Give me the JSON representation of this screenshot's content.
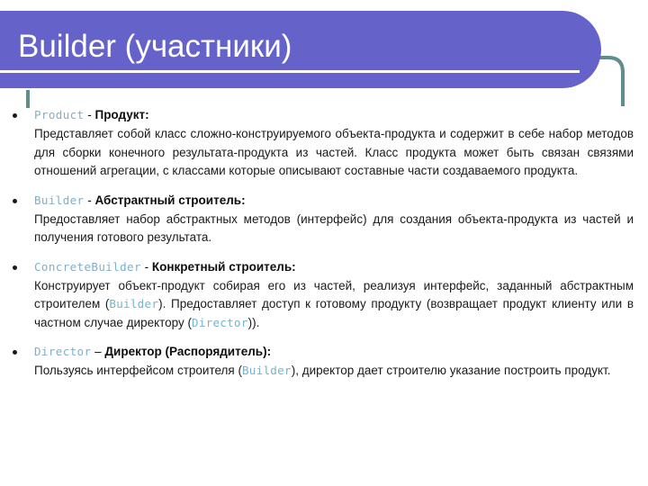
{
  "slide": {
    "title": "Builder (участники)",
    "theme": {
      "banner_color": "#6563c9",
      "banner_rule_color": "#ffffff",
      "accent_line_color": "#5f8e8e",
      "keyword_color": "#7fafc9",
      "inline_keyword_color": "#74b3cf",
      "body_text_color": "#1a1a1a",
      "background_color": "#ffffff"
    }
  },
  "bullets": [
    {
      "keyword": "Product",
      "separator": " - ",
      "term": "Продукт",
      "colon": ":",
      "body_parts": [
        {
          "type": "text",
          "value": "Представляет собой класс сложно-конструируемого объекта-продукта и содержит в себе набор методов для сборки конечного результата-продукта из частей. Класс продукта может быть связан связями отношений агрегации, с классами которые описывают составные части создаваемого продукта."
        }
      ]
    },
    {
      "keyword": "Builder",
      "separator": " - ",
      "term": "Абстрактный строитель",
      "colon": ":",
      "body_parts": [
        {
          "type": "text",
          "value": "Предоставляет набор абстрактных методов (интерфейс) для создания объекта-продукта из частей и получения готового результата."
        }
      ]
    },
    {
      "keyword": "ConcreteBuilder",
      "separator": " - ",
      "term": "Конкретный строитель",
      "colon": ":",
      "body_parts": [
        {
          "type": "text",
          "value": "Конструирует объект-продукт собирая его из частей, реализуя интерфейс, заданный абстрактным строителем ("
        },
        {
          "type": "keyword",
          "value": "Builder"
        },
        {
          "type": "text",
          "value": "). Предоставляет доступ к готовому продукту (возвращает продукт клиенту или в частном случае директору ("
        },
        {
          "type": "keyword",
          "value": "Director"
        },
        {
          "type": "text",
          "value": "))."
        }
      ]
    },
    {
      "keyword": "Director",
      "separator": " – ",
      "term": "Директор (Распорядитель)",
      "colon": ":",
      "body_parts": [
        {
          "type": "text",
          "value": " Пользуясь интерфейсом строителя ("
        },
        {
          "type": "keyword",
          "value": "Builder"
        },
        {
          "type": "text",
          "value": "), директор дает строителю указание построить продукт."
        }
      ]
    }
  ]
}
